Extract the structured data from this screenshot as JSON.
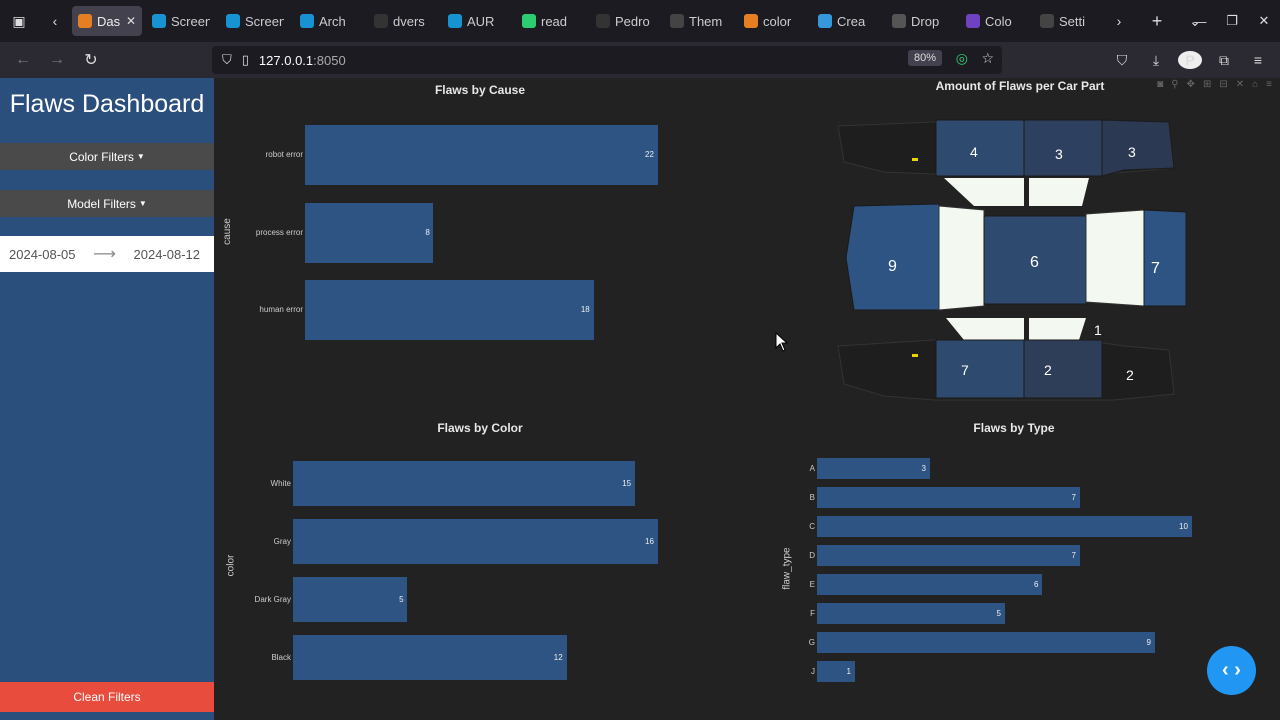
{
  "browser": {
    "tabs": [
      {
        "label": "Dash",
        "color": "#e67e22",
        "active": true
      },
      {
        "label": "Screen",
        "color": "#1793d1"
      },
      {
        "label": "Screen",
        "color": "#1793d1"
      },
      {
        "label": "Arch",
        "color": "#1793d1"
      },
      {
        "label": "dvers",
        "color": "#333333"
      },
      {
        "label": "AUR",
        "color": "#1793d1"
      },
      {
        "label": "read",
        "color": "#2ecc71"
      },
      {
        "label": "Pedro",
        "color": "#333333"
      },
      {
        "label": "Them",
        "color": "#444444"
      },
      {
        "label": "color",
        "color": "#e67e22"
      },
      {
        "label": "Crea",
        "color": "#3498db"
      },
      {
        "label": "Drop",
        "color": "#555555"
      },
      {
        "label": "Colo",
        "color": "#6f42c1"
      },
      {
        "label": "Setti",
        "color": "#444444"
      }
    ],
    "url_host": "127.0.0.1",
    "url_port": ":8050",
    "zoom": "80%",
    "avatar_letter": "P"
  },
  "sidebar": {
    "title": "Flaws Dashboard",
    "color_filters_label": "Color Filters",
    "model_filters_label": "Model Filters",
    "date_start": "2024-08-05",
    "date_end": "2024-08-12",
    "clean_filters_label": "Clean Filters"
  },
  "car_map": {
    "title": "Amount of Flaws per Car Part",
    "labels": [
      "4",
      "3",
      "3",
      "9",
      "6",
      "7",
      "1",
      "7",
      "2",
      "2"
    ]
  },
  "chart_data": [
    {
      "type": "bar",
      "orientation": "horizontal",
      "title": "Flaws by Cause",
      "ylabel": "cause",
      "categories": [
        "robot error",
        "process error",
        "human error"
      ],
      "values": [
        22,
        8,
        18
      ],
      "color": "#2e5484"
    },
    {
      "type": "bar",
      "orientation": "horizontal",
      "title": "Flaws by Color",
      "ylabel": "color",
      "categories": [
        "White",
        "Gray",
        "Dark Gray",
        "Black"
      ],
      "values": [
        15,
        16,
        5,
        12
      ],
      "color": "#2e5484"
    },
    {
      "type": "bar",
      "orientation": "horizontal",
      "title": "Flaws by Type",
      "ylabel": "flaw_type",
      "categories": [
        "A",
        "B",
        "C",
        "D",
        "E",
        "F",
        "G",
        "J"
      ],
      "values": [
        3,
        7,
        10,
        7,
        6,
        5,
        9,
        1
      ],
      "color": "#2e5484"
    }
  ]
}
